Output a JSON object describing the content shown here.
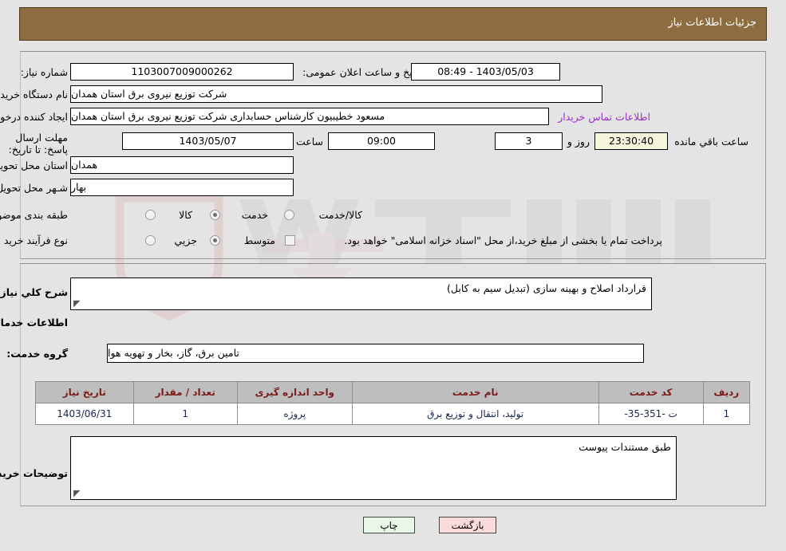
{
  "header": {
    "title": "جزئیات اطلاعات نیاز"
  },
  "form": {
    "need_number_label": "شماره نیاز:",
    "need_number_value": "1103007009000262",
    "public_announce_label": "تاریخ و ساعت اعلان عمومی:",
    "public_announce_value": "1403/05/03 - 08:49",
    "buyer_org_label": "نام دستگاه خریدار:",
    "buyer_org_value": "شرکت توزیع نیروی برق استان همدان",
    "requester_label": "ایجاد کننده درخواست:",
    "requester_value": "مسعود خطیبیون کارشناس حسابداری شرکت توزیع نیروی برق استان همدان",
    "contact_link": "اطلاعات تماس خریدار",
    "deadline_label": "مهلت ارسال پاسخ: تا تاریخ:",
    "deadline_date": "1403/05/07",
    "time_label": "ساعت",
    "time_value": "09:00",
    "days_value": "3",
    "days_label": "روز و",
    "countdown_value": "23:30:40",
    "countdown_label": "ساعت باقي مانده",
    "province_label": "استان محل تحویل:",
    "province_value": "همدان",
    "city_label": "شـهر محل تحویل:",
    "city_value": "بهار",
    "category_label": "طبقه بندی موضوعی:",
    "category_options": [
      {
        "label": "کالا",
        "selected": false
      },
      {
        "label": "خدمت",
        "selected": true
      },
      {
        "label": "کالا/خدمت",
        "selected": false
      }
    ],
    "process_label": "نوع فرآیند خرید :",
    "process_options": [
      {
        "label": "جزیي",
        "selected": false
      },
      {
        "label": "متوسط",
        "selected": true
      }
    ],
    "treasury_checkbox_text": "پرداخت تمام یا بخشی از مبلغ خرید،از محل \"اسناد خزانه اسلامی\" خواهد بود."
  },
  "description": {
    "need_summary_label": "شرح کلي نیاز:",
    "need_summary_value": "قرارداد اصلاح و بهینه سازی (تبدیل سیم به کابل)",
    "services_section_title": "اطلاعات خدمات مورد نیاز",
    "service_group_label": "گروه خدمت:",
    "service_group_value": "تامین برق، گاز، بخار و تهویه هوا"
  },
  "table": {
    "headers": [
      "ردیف",
      "کد خدمت",
      "نام خدمت",
      "واحد اندازه گیری",
      "تعداد / مقدار",
      "تاریخ نیاز"
    ],
    "rows": [
      {
        "row_no": "1",
        "service_code": "ت -351-35-",
        "service_name": "تولید، انتقال و توزیع برق",
        "unit": "پروژه",
        "quantity": "1",
        "need_date": "1403/06/31"
      }
    ]
  },
  "buyer_notes": {
    "label": "توضیحات خریدار:",
    "value": "طبق مستندات پیوست"
  },
  "footer": {
    "print_label": "چاپ",
    "back_label": "بازگشت"
  },
  "watermark": {
    "text": "AriaTender.net"
  },
  "colors": {
    "header_bg": "#8d6c42",
    "page_bg": "#e4e4e4",
    "link": "#9b30c9",
    "table_header_text": "#7b1a1a",
    "table_cell_text": "#16264a",
    "countdown_bg": "#f7f4dc",
    "print_bg": "#e9f7e9",
    "back_bg": "#fadada"
  }
}
